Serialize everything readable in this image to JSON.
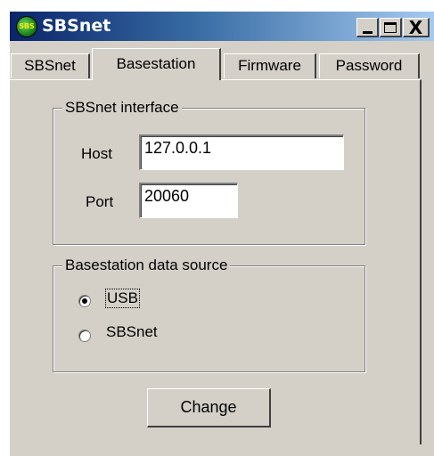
{
  "window": {
    "title": "SBSnet",
    "app_icon_text": "SBS",
    "controls": {
      "minimize": "minimize-icon",
      "maximize": "maximize-icon",
      "close": "close-icon"
    },
    "close_glyph": "X"
  },
  "tabs": [
    {
      "label": "SBSnet",
      "active": false
    },
    {
      "label": "Basestation",
      "active": true
    },
    {
      "label": "Firmware",
      "active": false
    },
    {
      "label": "Password",
      "active": false
    }
  ],
  "sbsnet_interface": {
    "legend": "SBSnet interface",
    "host_label": "Host",
    "host_value": "127.0.0.1",
    "port_label": "Port",
    "port_value": "20060"
  },
  "data_source": {
    "legend": "Basestation data source",
    "options": [
      {
        "label": "USB",
        "selected": true
      },
      {
        "label": "SBSnet",
        "selected": false
      }
    ]
  },
  "change_button": "Change",
  "colors": {
    "face": "#d4d0c8",
    "title_start": "#0a246a",
    "title_end": "#a6caf0"
  }
}
